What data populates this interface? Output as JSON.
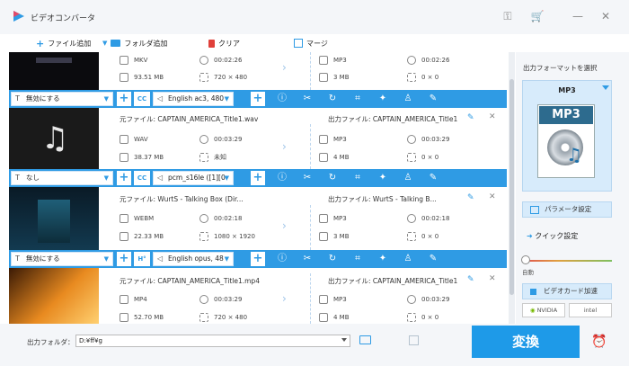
{
  "window": {
    "title": "ビデオコンバータ",
    "minimize": "—",
    "close": "✕"
  },
  "toolbar": {
    "add_file": "ファイル追加",
    "add_folder": "フォルダ追加",
    "clear": "クリア",
    "merge": "マージ"
  },
  "files": [
    {
      "src_label": "",
      "src_name": "",
      "out_label": "",
      "out_name": "",
      "src": {
        "format": "MKV",
        "duration": "00:02:26",
        "size": "93.51 MB",
        "resolution": "720 × 480"
      },
      "out": {
        "format": "MP3",
        "duration": "00:02:26",
        "size": "3 MB",
        "resolution": "0 × 0"
      },
      "edit": {
        "subtitle": "無効にする",
        "audio": "English ac3, 480"
      }
    },
    {
      "src_label": "元ファイル:",
      "src_name": "CAPTAIN_AMERICA_Title1.wav",
      "out_label": "出力ファイル:",
      "out_name": "CAPTAIN_AMERICA_Title1",
      "src": {
        "format": "WAV",
        "duration": "00:03:29",
        "size": "38.37 MB",
        "resolution": "未知"
      },
      "out": {
        "format": "MP3",
        "duration": "00:03:29",
        "size": "4 MB",
        "resolution": "0 × 0"
      },
      "edit": {
        "subtitle": "なし",
        "audio": "pcm_s16le ([1][0"
      }
    },
    {
      "src_label": "元ファイル:",
      "src_name": "WurtS - Talking Box (Dir...",
      "out_label": "出力ファイル:",
      "out_name": "WurtS - Talking B...",
      "src": {
        "format": "WEBM",
        "duration": "00:02:18",
        "size": "22.33 MB",
        "resolution": "1080 × 1920"
      },
      "out": {
        "format": "MP3",
        "duration": "00:02:18",
        "size": "3 MB",
        "resolution": "0 × 0"
      },
      "edit": {
        "subtitle": "無効にする",
        "audio": "English opus, 48"
      }
    },
    {
      "src_label": "元ファイル:",
      "src_name": "CAPTAIN_AMERICA_Title1.mp4",
      "out_label": "出力ファイル:",
      "out_name": "CAPTAIN_AMERICA_Title1",
      "src": {
        "format": "MP4",
        "duration": "00:03:29",
        "size": "52.70 MB",
        "resolution": "720 × 480"
      },
      "out": {
        "format": "MP3",
        "duration": "00:03:29",
        "size": "4 MB",
        "resolution": "0 × 0"
      }
    }
  ],
  "right_panel": {
    "format_title": "出力フォーマットを選択",
    "format_name": "MP3",
    "format_icon_text": "MP3",
    "param_button": "パラメータ設定",
    "quick_label": "クイック設定",
    "auto_label": "自動",
    "gpu_button": "ビデオカード加速",
    "nvidia": "NVIDIA",
    "intel": "intel"
  },
  "bottom": {
    "output_label": "出力フォルダ：",
    "output_path": "D:¥ff¥g",
    "run_button": "変換"
  },
  "colors": {
    "accent": "#2f9be4",
    "run": "#1e9ae8"
  }
}
